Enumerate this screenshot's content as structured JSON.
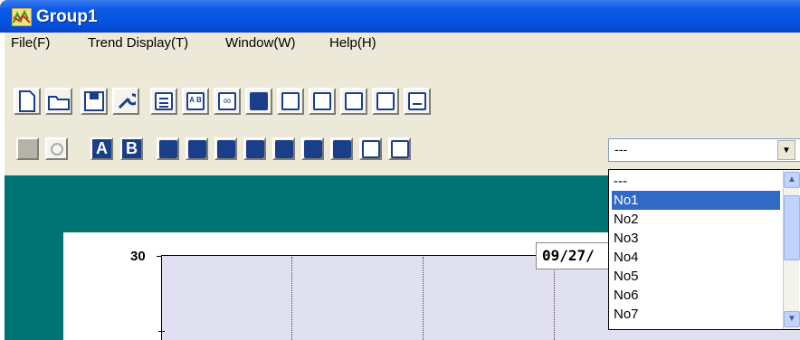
{
  "window": {
    "title": "Group1"
  },
  "menu": [
    {
      "label": "File(F)"
    },
    {
      "label": "Trend Display(T)"
    },
    {
      "label": "Window(W)"
    },
    {
      "label": "Help(H)"
    }
  ],
  "toolbar2": {
    "button_a": "A",
    "button_b": "B"
  },
  "combo": {
    "value": "---"
  },
  "dropdown": {
    "options": [
      "---",
      "No1",
      "No2",
      "No3",
      "No4",
      "No5",
      "No6",
      "No7"
    ],
    "selected": "No1"
  },
  "chart": {
    "y_max_label": "30",
    "date_label": "09/27/"
  },
  "colors": {
    "title_bar": "#0a5ae6",
    "graph_background": "#007373",
    "plot_background": "#e0e0f0",
    "selection": "#316ac5"
  }
}
